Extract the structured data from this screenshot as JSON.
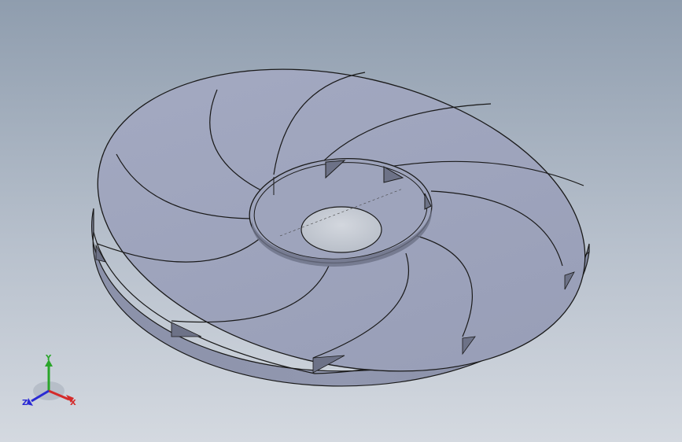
{
  "viewport": {
    "background_top": "#8f9dae",
    "background_bottom": "#d4d9e0"
  },
  "model": {
    "name": "centrifugal-impeller",
    "blade_count": 11,
    "face_color": "#9ea4bc",
    "side_color": "#8c92aa",
    "edge_color": "#1a1a1a",
    "hole_color": "#c9ced6"
  },
  "triad": {
    "x_label": "X",
    "y_label": "Y",
    "z_label": "Z",
    "x_color": "#d42a2a",
    "y_color": "#2aa52a",
    "z_color": "#2a2ad4"
  }
}
